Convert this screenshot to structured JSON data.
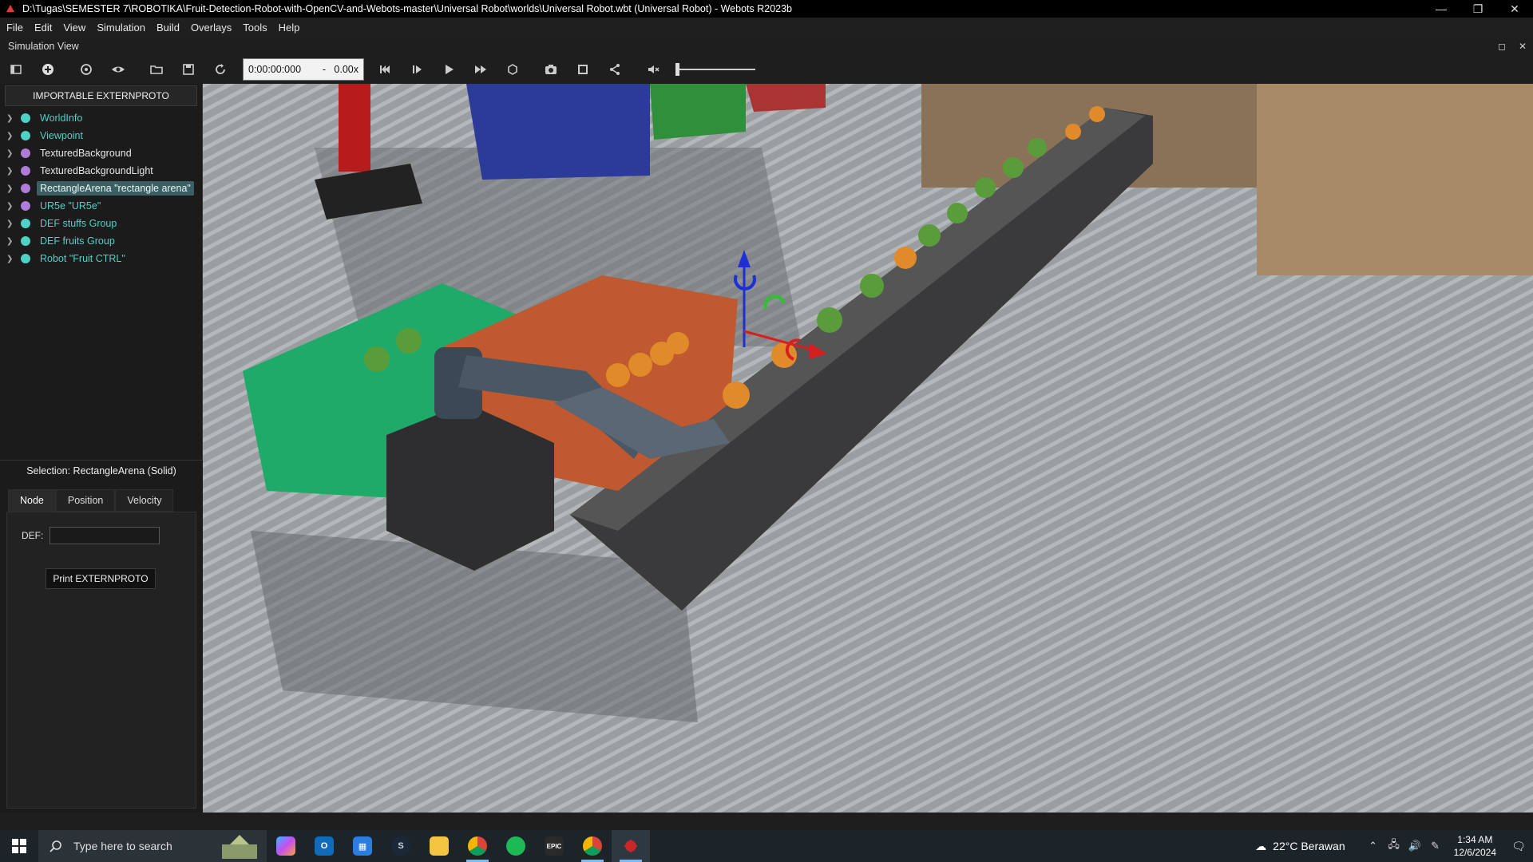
{
  "window": {
    "title": "D:\\Tugas\\SEMESTER 7\\ROBOTIKA\\Fruit-Detection-Robot-with-OpenCV-and-Webots-master\\Universal Robot\\worlds\\Universal Robot.wbt (Universal Robot) - Webots R2023b",
    "minimize": "—",
    "restore": "❐",
    "close": "✕"
  },
  "menu": [
    "File",
    "Edit",
    "View",
    "Simulation",
    "Build",
    "Overlays",
    "Tools",
    "Help"
  ],
  "sim_view": {
    "label": "Simulation View",
    "maximize": "◻",
    "close": "✕"
  },
  "toolbar": {
    "time": "0:00:00:000",
    "dash": "-",
    "speed": "0.00x",
    "volume_level": 0.0
  },
  "scene_tree": {
    "extern_button": "IMPORTABLE EXTERNPROTO",
    "items": [
      {
        "label": "WorldInfo",
        "color": "#4fd1c5"
      },
      {
        "label": "Viewpoint",
        "color": "#4fd1c5"
      },
      {
        "label": "TexturedBackground",
        "color": "#b07cd8"
      },
      {
        "label": "TexturedBackgroundLight",
        "color": "#b07cd8"
      },
      {
        "label": "RectangleArena \"rectangle arena\"",
        "color": "#b07cd8"
      },
      {
        "label": "UR5e \"UR5e\"",
        "color": "#b07cd8"
      },
      {
        "label": "DEF stuffs Group",
        "color": "#4fd1c5"
      },
      {
        "label": "DEF fruits Group",
        "color": "#4fd1c5"
      },
      {
        "label": "Robot \"Fruit CTRL\"",
        "color": "#4fd1c5"
      }
    ],
    "selected_index": 4
  },
  "selection": {
    "title": "Selection: RectangleArena (Solid)",
    "tabs": [
      "Node",
      "Position",
      "Velocity"
    ],
    "active_tab": 0,
    "def_label": "DEF:",
    "def_value": "",
    "print_button": "Print EXTERNPROTO"
  },
  "taskbar": {
    "search_placeholder": "Type here to search",
    "apps": [
      "copilot",
      "outlook",
      "store",
      "steam",
      "file-explorer",
      "chrome",
      "spotify",
      "epic-games",
      "chrome-profile",
      "webots"
    ],
    "weather": {
      "temp": "22°C",
      "desc": "Berawan"
    },
    "time": "1:34 AM",
    "date": "12/6/2024"
  }
}
